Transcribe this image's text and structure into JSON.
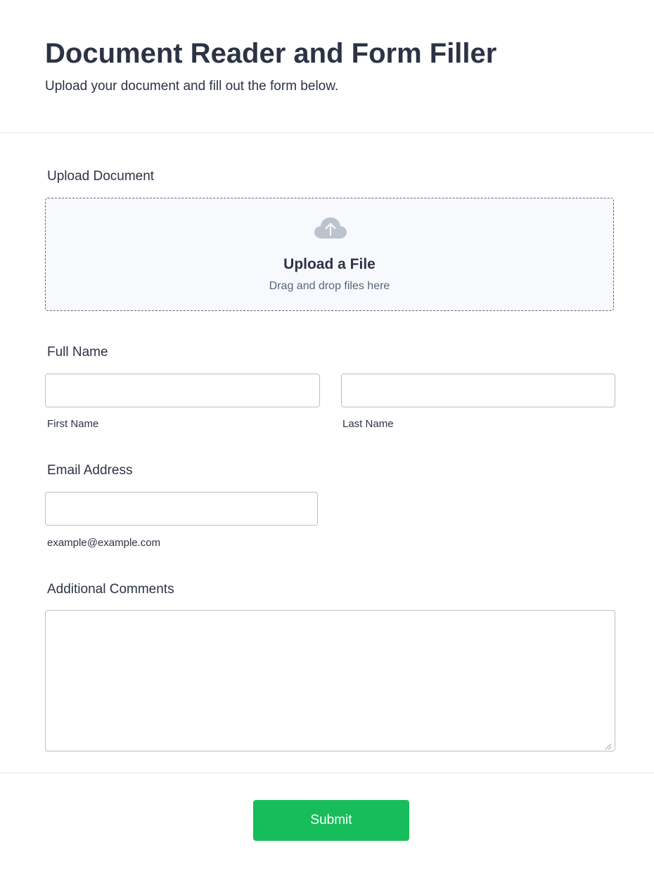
{
  "header": {
    "title": "Document Reader and Form Filler",
    "subtitle": "Upload your document and fill out the form below."
  },
  "upload": {
    "section_label": "Upload Document",
    "title": "Upload a File",
    "subtitle": "Drag and drop files here",
    "icon": "cloud-upload-icon"
  },
  "full_name": {
    "section_label": "Full Name",
    "first_name": {
      "value": "",
      "sublabel": "First Name"
    },
    "last_name": {
      "value": "",
      "sublabel": "Last Name"
    }
  },
  "email": {
    "section_label": "Email Address",
    "value": "",
    "sublabel": "example@example.com"
  },
  "comments": {
    "section_label": "Additional Comments",
    "value": ""
  },
  "submit": {
    "label": "Submit"
  },
  "colors": {
    "text": "#2c3345",
    "muted_text": "#57647e",
    "submit_bg": "#18bd5b",
    "upload_bg": "#f8f9fc",
    "cloud_icon": "#bcc3cf",
    "input_border": "#b8bdc9"
  }
}
